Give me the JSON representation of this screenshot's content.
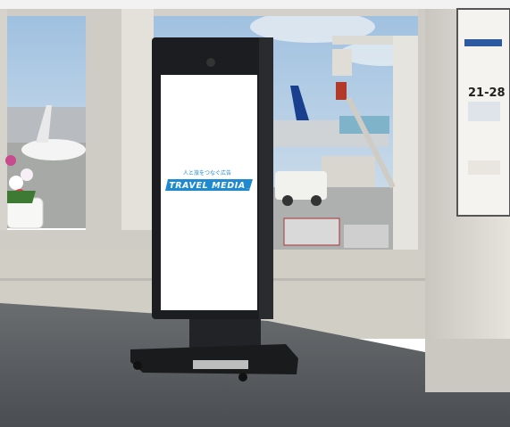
{
  "signage": {
    "tagline": "人と旅をつなぐ広告",
    "brand": "TRAVEL MEDIA",
    "brand_suffix": "..."
  },
  "gate_sign": {
    "gates": "21-28"
  },
  "colors": {
    "brand_blue": "#1f8ad0",
    "sky": "#b9d3ea",
    "floor": "#55585c",
    "wall": "#dcd9d2",
    "kiosk": "#1c1d20",
    "screen": "#ffffff"
  }
}
